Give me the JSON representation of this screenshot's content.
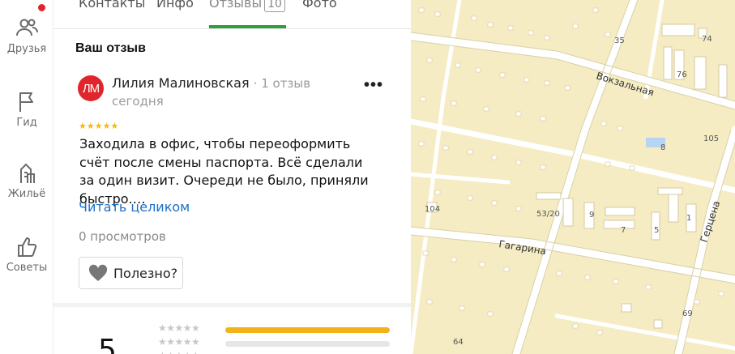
{
  "sidebar": {
    "items": [
      {
        "label": "Друзья",
        "icon": "friends-icon"
      },
      {
        "label": "Гид",
        "icon": "flag-icon"
      },
      {
        "label": "Жильё",
        "icon": "building-icon"
      },
      {
        "label": "Советы",
        "icon": "thumbs-up-icon"
      }
    ],
    "notification_dot": true
  },
  "tabs": [
    {
      "label": "Контакты"
    },
    {
      "label": "Инфо"
    },
    {
      "label": "Отзывы",
      "count": "10",
      "active": true
    },
    {
      "label": "Фото"
    }
  ],
  "review": {
    "section_title": "Ваш отзыв",
    "avatar_initials": "ЛМ",
    "author": "Лилия Малиновская",
    "author_meta": "· 1 отзыв",
    "date": "сегодня",
    "more": "•••",
    "stars": "★★★★★",
    "rating": 5,
    "text": "Заходила в офис, чтобы переоформить счёт после смены паспорта. Всё сделали за один визит. Очереди не было, приняли быстро.…",
    "read_more": "Читать целиком",
    "views": "0 просмотров",
    "useful_label": "Полезно?"
  },
  "rating_summary": {
    "average": "5",
    "distribution": [
      {
        "stars": "★★★★★",
        "fraction": 1.0
      },
      {
        "stars": "★★★★★",
        "fraction": 0.0
      },
      {
        "stars": "★★★★★",
        "fraction": 0.0
      }
    ]
  },
  "map": {
    "streets": [
      "Вокзальная",
      "Гагарина",
      "Герцена"
    ],
    "house_numbers": [
      "35",
      "74",
      "76",
      "8",
      "105",
      "104",
      "53/20",
      "9",
      "7",
      "5",
      "1",
      "64",
      "69"
    ],
    "colors": {
      "land": "#f5ecc3",
      "road": "#ffffff",
      "building": "#ffffff",
      "water": "#b7d4f0"
    }
  }
}
